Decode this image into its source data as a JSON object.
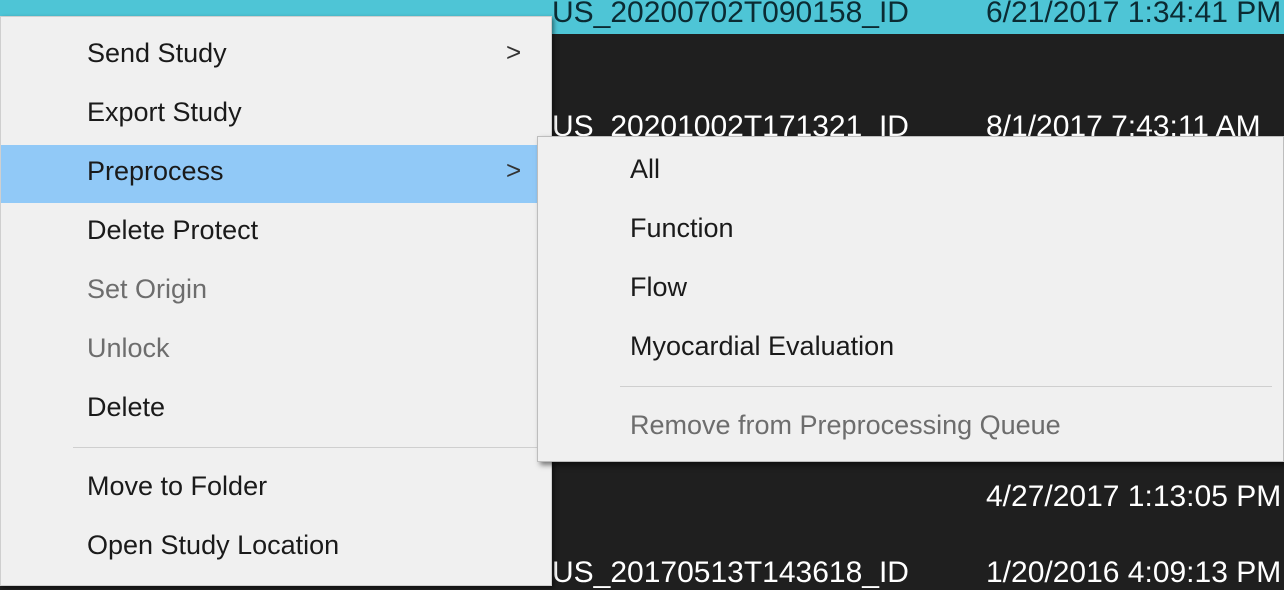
{
  "study_list": {
    "rows": [
      {
        "id": "US_20200702T090158_ID",
        "date": "6/21/2017 1:34:41 PM",
        "prefix": "...",
        "selected": true
      },
      {
        "id": "US_20201002T171321_ID",
        "date": "8/1/2017 7:43:11 AM"
      },
      {
        "date": "4/27/2017 1:13:05 PM"
      },
      {
        "id": "US_20170513T143618_ID",
        "date": "1/20/2016 4:09:13 PM"
      }
    ]
  },
  "context_menu": {
    "items": [
      {
        "label": "Send Study",
        "submenu": true,
        "arrow": ">"
      },
      {
        "label": "Export Study"
      },
      {
        "label": "Preprocess",
        "submenu": true,
        "arrow": ">",
        "highlighted": true
      },
      {
        "label": "Delete Protect"
      },
      {
        "label": "Set Origin",
        "disabled": true
      },
      {
        "label": "Unlock",
        "disabled": true
      },
      {
        "label": "Delete"
      },
      {
        "label": "Move to Folder"
      },
      {
        "label": "Open Study Location"
      }
    ]
  },
  "preprocess_submenu": {
    "items": [
      {
        "label": "All"
      },
      {
        "label": "Function"
      },
      {
        "label": "Flow"
      },
      {
        "label": "Myocardial Evaluation"
      },
      {
        "label": "Remove from Preprocessing Queue",
        "disabled": true
      }
    ]
  },
  "colors": {
    "selected_row": "#4ec5d6",
    "menu_bg": "#f0f0f0",
    "menu_highlight": "#91c9f7",
    "list_bg": "#1f1f1f"
  }
}
